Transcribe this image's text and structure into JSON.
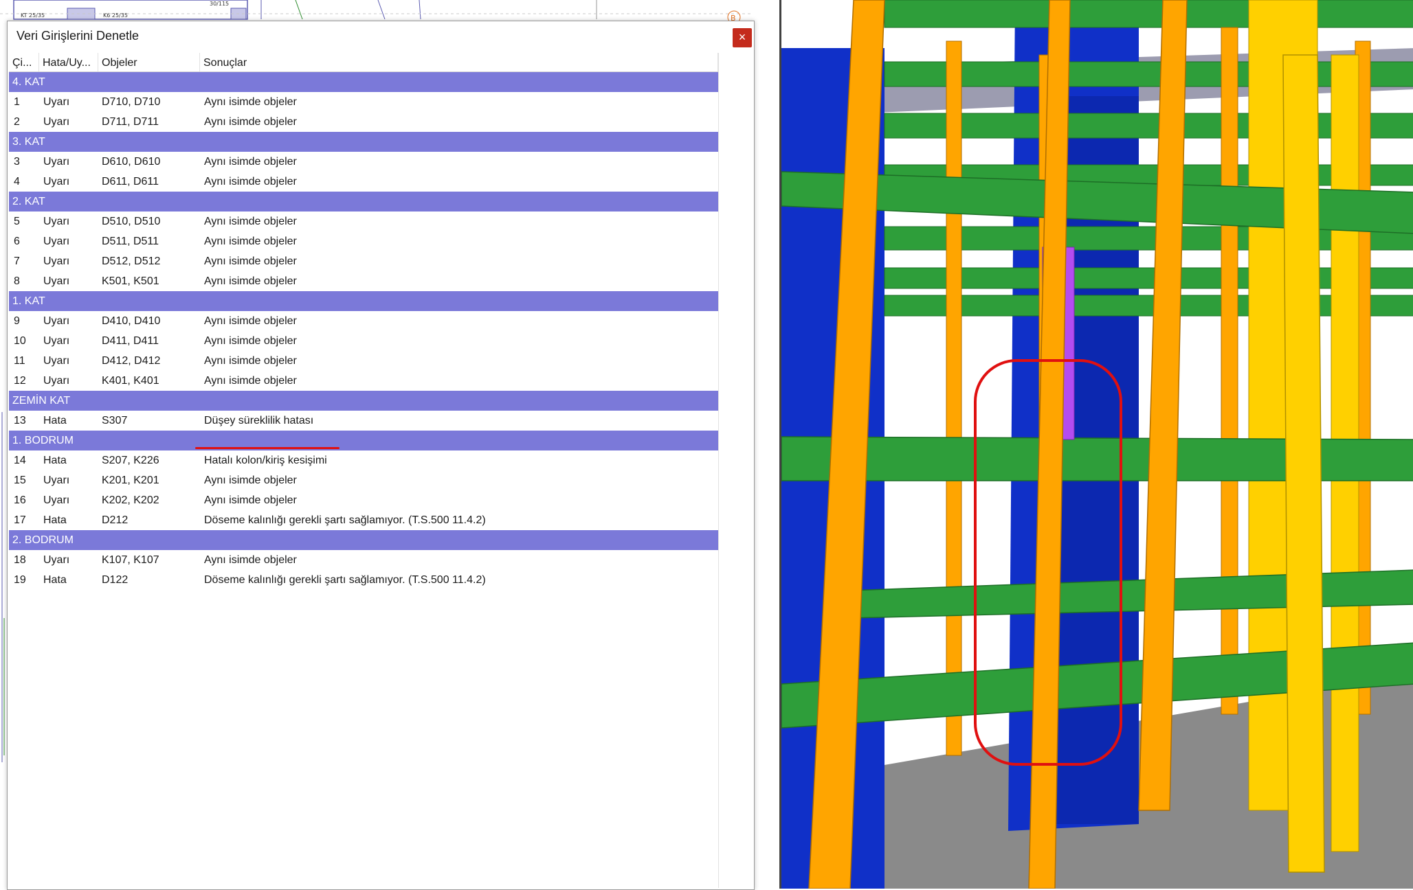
{
  "dialog": {
    "title": "Veri Girişlerini Denetle",
    "close_label": "×"
  },
  "columns": {
    "no": "Çi...",
    "type": "Hata/Uy...",
    "objects": "Objeler",
    "results": "Sonuçlar"
  },
  "groups": [
    {
      "label": "4. KAT",
      "rows": [
        {
          "no": "1",
          "type": "Uyarı",
          "objects": "D710, D710",
          "result": "Aynı isimde objeler"
        },
        {
          "no": "2",
          "type": "Uyarı",
          "objects": "D711, D711",
          "result": "Aynı isimde objeler"
        }
      ]
    },
    {
      "label": "3. KAT",
      "rows": [
        {
          "no": "3",
          "type": "Uyarı",
          "objects": "D610, D610",
          "result": "Aynı isimde objeler"
        },
        {
          "no": "4",
          "type": "Uyarı",
          "objects": "D611, D611",
          "result": "Aynı isimde objeler"
        }
      ]
    },
    {
      "label": "2. KAT",
      "rows": [
        {
          "no": "5",
          "type": "Uyarı",
          "objects": "D510, D510",
          "result": "Aynı isimde objeler"
        },
        {
          "no": "6",
          "type": "Uyarı",
          "objects": "D511, D511",
          "result": "Aynı isimde objeler"
        },
        {
          "no": "7",
          "type": "Uyarı",
          "objects": "D512, D512",
          "result": "Aynı isimde objeler"
        },
        {
          "no": "8",
          "type": "Uyarı",
          "objects": "K501, K501",
          "result": "Aynı isimde objeler"
        }
      ]
    },
    {
      "label": "1. KAT",
      "rows": [
        {
          "no": "9",
          "type": "Uyarı",
          "objects": "D410, D410",
          "result": "Aynı isimde objeler"
        },
        {
          "no": "10",
          "type": "Uyarı",
          "objects": "D411, D411",
          "result": "Aynı isimde objeler"
        },
        {
          "no": "11",
          "type": "Uyarı",
          "objects": "D412, D412",
          "result": "Aynı isimde objeler"
        },
        {
          "no": "12",
          "type": "Uyarı",
          "objects": "K401, K401",
          "result": "Aynı isimde objeler"
        }
      ]
    },
    {
      "label": "ZEMİN KAT",
      "rows": [
        {
          "no": "13",
          "type": "Hata",
          "objects": "S307",
          "result": "Düşey süreklilik hatası"
        }
      ]
    },
    {
      "label": "1. BODRUM",
      "rows": [
        {
          "no": "14",
          "type": "Hata",
          "objects": "S207, K226",
          "result": "Hatalı kolon/kiriş kesişimi"
        },
        {
          "no": "15",
          "type": "Uyarı",
          "objects": "K201, K201",
          "result": "Aynı isimde objeler"
        },
        {
          "no": "16",
          "type": "Uyarı",
          "objects": "K202, K202",
          "result": "Aynı isimde objeler"
        },
        {
          "no": "17",
          "type": "Hata",
          "objects": "D212",
          "result": "Döseme kalınlığı gerekli şartı sağlamıyor. (T.S.500 11.4.2)"
        }
      ]
    },
    {
      "label": "2. BODRUM",
      "rows": [
        {
          "no": "18",
          "type": "Uyarı",
          "objects": "K107, K107",
          "result": "Aynı isimde objeler"
        },
        {
          "no": "19",
          "type": "Hata",
          "objects": "D122",
          "result": "Döseme kalınlığı gerekli şartı sağlamıyor. (T.S.500 11.4.2)"
        }
      ]
    }
  ],
  "colors": {
    "group_header": "#7b79d9",
    "beam": "#2e9e3a",
    "column_orange": "#ffa500",
    "column_yellow": "#ffd000",
    "shear_wall": "#1030c8",
    "highlight_column": "#b44cf0",
    "annotation": "#e01010"
  },
  "cad": {
    "labels": [
      "KT 25/35",
      "K6 25/35",
      "30/115",
      "B"
    ]
  }
}
